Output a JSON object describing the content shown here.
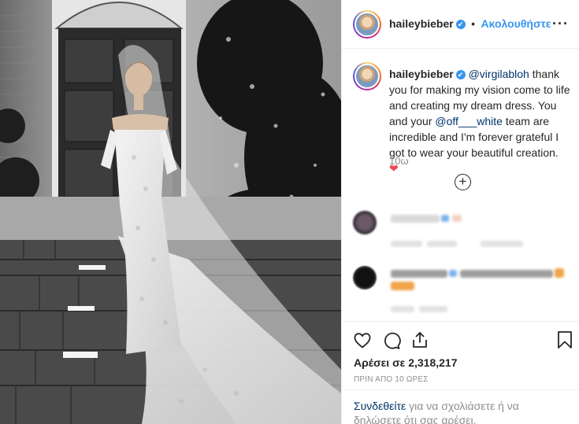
{
  "post": {
    "username": "haileybieber",
    "verified_mark": "✔",
    "follow_separator": "•",
    "follow_label": "Ακολουθήστε",
    "more_label": "···"
  },
  "caption": {
    "username": "haileybieber",
    "mention_1": "@virgilabloh",
    "text_1": " thank you for making my vision come to life and creating my dream dress. You and your ",
    "mention_2": "@off___white",
    "text_2": " team are incredible and I'm forever grateful I got to wear your beautiful creation. ",
    "heart": "❤",
    "time": "10ω"
  },
  "load_more": {
    "label": "+"
  },
  "actions": {
    "likes": "Αρέσει σε 2,318,217",
    "posted_ago": "ΠΡΙΝ ΑΠΟ 10 ΩΡΕΣ",
    "login_link": "Συνδεθείτε",
    "login_text": " για να σχολιάσετε ή να δηλώσετε ότι σας αρέσει."
  },
  "icons": {
    "like": "heart-outline-icon",
    "comment": "comment-icon",
    "share": "share-icon",
    "save": "bookmark-icon"
  },
  "colors": {
    "link": "#3897f0",
    "mention": "#003569",
    "heart": "#ed4956",
    "muted": "#8e8e8e",
    "border": "#efefef"
  }
}
